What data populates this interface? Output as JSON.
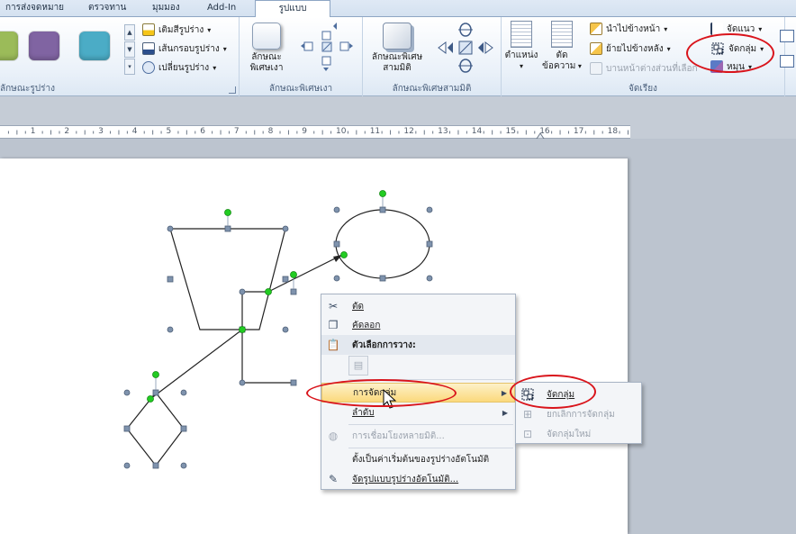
{
  "tabs": [
    "การส่งจดหมาย",
    "ตรวจทาน",
    "มุมมอง",
    "Add-In",
    "รูปแบบ"
  ],
  "ribbon": {
    "shape_styles": {
      "label": "ลักษณะรูปร่าง",
      "swatch_colors": [
        "#9bbb59",
        "#8064a2",
        "#4bacc6"
      ],
      "fill": "เติมสีรูปร่าง",
      "outline": "เส้นกรอบรูปร่าง",
      "change": "เปลี่ยนรูปร่าง"
    },
    "shadow_effects": {
      "button": "ลักษณะ\nพิเศษเงา",
      "label": "ลักษณะพิเศษเงา"
    },
    "3d_effects": {
      "button": "ลักษณะพิเศษ\nสามมิติ",
      "label": "ลักษณะพิเศษสามมิติ"
    },
    "arrange": {
      "label": "จัดเรียง",
      "position": "ตำแหน่ง",
      "wrap_text": "ตัด\nข้อความ",
      "bring_forward": "นำไปข้างหน้า",
      "send_backward": "ย้ายไปข้างหลัง",
      "selection_pane": "บานหน้าต่างส่วนที่เลือก",
      "align": "จัดแนว",
      "group": "จัดกลุ่ม",
      "rotate": "หมุน"
    }
  },
  "ruler": {
    "numbers": [
      "1",
      "2",
      "3",
      "4",
      "5",
      "6",
      "7",
      "8",
      "9",
      "10",
      "11",
      "12",
      "13",
      "14",
      "15",
      "16",
      "17",
      "18"
    ]
  },
  "context_menu": {
    "items": [
      {
        "label": "ตัด",
        "icon": "scissors-icon"
      },
      {
        "label": "คัดลอก",
        "icon": "copy-icon"
      },
      {
        "label": "ตัวเลือกการวาง:",
        "icon": "paste-icon"
      },
      {
        "label": "การจัดกลุ่ม",
        "icon": ""
      },
      {
        "label": "ลำดับ",
        "icon": ""
      },
      {
        "label": "การเชื่อมโยงหลายมิติ...",
        "icon": "globe-link-icon"
      },
      {
        "label": "ตั้งเป็นค่าเริ่มต้นของรูปร่างอัตโนมัติ",
        "icon": ""
      },
      {
        "label": "จัดรูปแบบรูปร่างอัตโนมัติ...",
        "icon": "format-shape-icon"
      }
    ]
  },
  "submenu": {
    "items": [
      {
        "label": "จัดกลุ่ม",
        "icon": "group-icon"
      },
      {
        "label": "ยกเลิกการจัดกลุ่ม",
        "icon": "ungroup-icon"
      },
      {
        "label": "จัดกลุ่มใหม่",
        "icon": "regroup-icon"
      }
    ]
  },
  "colors": {
    "highlight": "#d9141b",
    "handle": "#7f93ad",
    "rotate_handle": "#22cc22"
  }
}
